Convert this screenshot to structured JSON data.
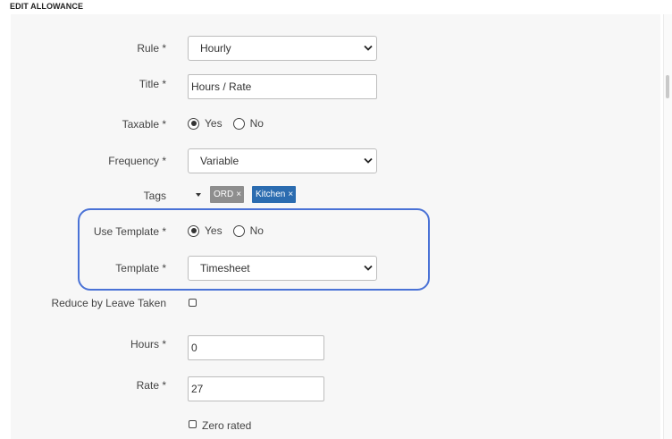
{
  "section_title": "EDIT ALLOWANCE",
  "form": {
    "rule": {
      "label": "Rule *",
      "value": "Hourly"
    },
    "title": {
      "label": "Title *",
      "value": "Hours / Rate"
    },
    "taxable": {
      "label": "Taxable *",
      "options": [
        "Yes",
        "No"
      ],
      "selected": "Yes"
    },
    "frequency": {
      "label": "Frequency *",
      "value": "Variable"
    },
    "tags": {
      "label": "Tags",
      "items": [
        {
          "text": "ORD",
          "color": "#8e8e8e"
        },
        {
          "text": "Kitchen",
          "color": "#2b6cb0"
        }
      ],
      "remove_glyph": "×"
    },
    "use_template": {
      "label": "Use Template *",
      "options": [
        "Yes",
        "No"
      ],
      "selected": "Yes"
    },
    "template": {
      "label": "Template *",
      "value": "Timesheet"
    },
    "reduce_by_leave": {
      "label": "Reduce by Leave Taken",
      "checked": false
    },
    "hours": {
      "label": "Hours *",
      "value": "0"
    },
    "rate": {
      "label": "Rate *",
      "value": "27"
    },
    "zero_rated": {
      "label": "Zero rated",
      "checked": false
    }
  },
  "colors": {
    "highlight": "#4a72d6",
    "panel_bg": "#f7f7f7"
  }
}
